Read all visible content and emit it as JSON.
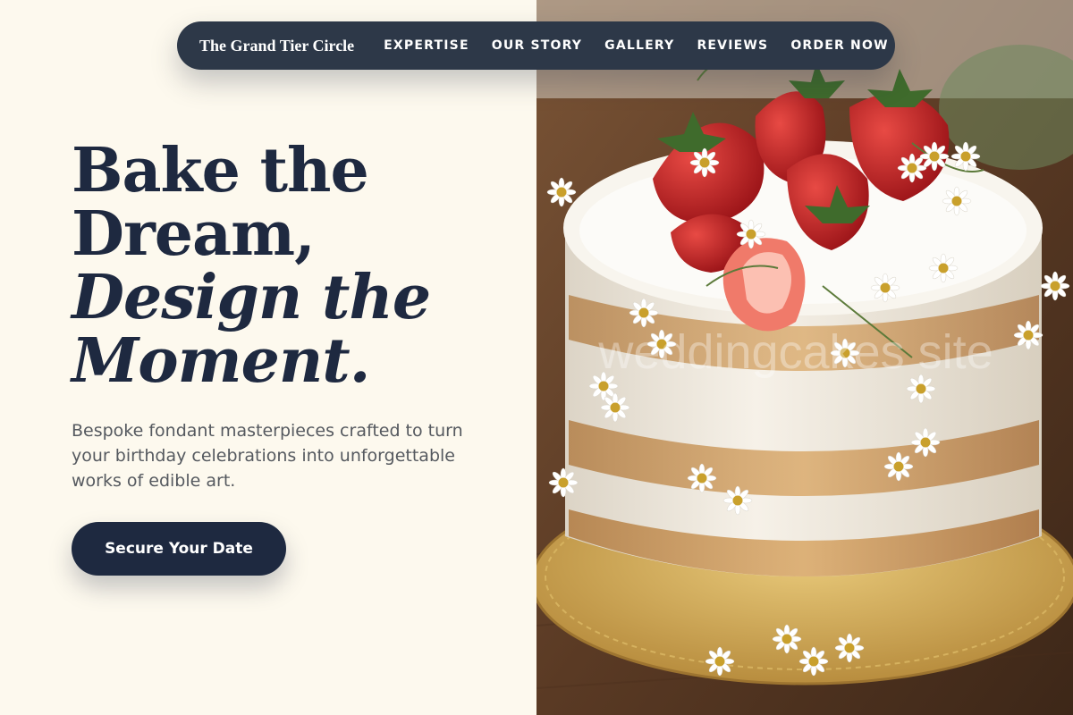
{
  "nav": {
    "brand": "The Grand Tier Circle",
    "links": [
      {
        "label": "EXPERTISE"
      },
      {
        "label": "OUR STORY"
      },
      {
        "label": "GALLERY"
      },
      {
        "label": "REVIEWS"
      },
      {
        "label": "ORDER NOW"
      }
    ]
  },
  "hero": {
    "headline": {
      "line1": "Bake the",
      "line2": "Dream,",
      "line3": "Design the",
      "line4": "Moment."
    },
    "subtitle": "Bespoke fondant masterpieces crafted to turn your birthday celebrations into unforgettable works of edible art.",
    "cta_label": "Secure Your Date",
    "watermark": "weddingcakes site"
  },
  "colors": {
    "background": "#fdf9ee",
    "navy": "#1e2940",
    "nav_bar": "#2d3848",
    "body_text": "#55595f"
  },
  "icons": {
    "hero_image": "cake-with-strawberries-and-daisies-photo"
  }
}
